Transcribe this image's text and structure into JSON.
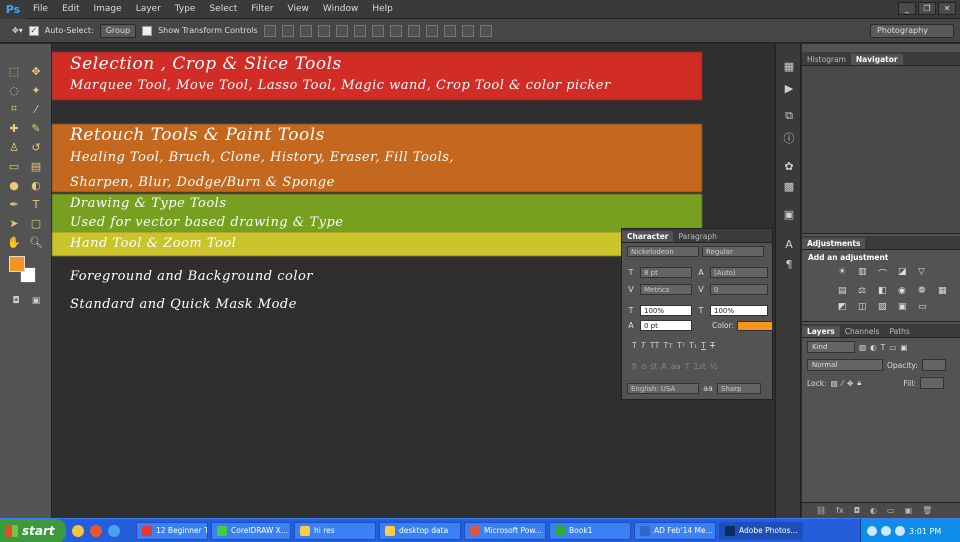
{
  "app": {
    "logo": "Ps"
  },
  "menu": [
    "File",
    "Edit",
    "Image",
    "Layer",
    "Type",
    "Select",
    "Filter",
    "View",
    "Window",
    "Help"
  ],
  "window_controls": [
    "_",
    "❐",
    "✕"
  ],
  "options_bar": {
    "auto_select_label": "Auto-Select:",
    "auto_select_value": "Group",
    "transform_label": "Show Transform Controls",
    "workspace": "Photography"
  },
  "annotations": {
    "selection_title": "Selection , Crop & Slice Tools",
    "selection_desc": "Marquee Tool, Move Tool, Lasso Tool, Magic wand, Crop Tool & color picker",
    "retouch_title": "Retouch Tools & Paint Tools",
    "retouch_desc": "Healing Tool, Bruch, Clone, History, Eraser, Fill Tools,",
    "retouch_desc2": "Sharpen, Blur, Dodge/Burn & Sponge",
    "drawing_title": "Drawing & Type Tools",
    "drawing_desc": "Used for vector based drawing & Type",
    "hand_zoom": "Hand Tool & Zoom Tool",
    "fg_bg": "Foreground and Background color",
    "mask_mode": "Standard and Quick Mask Mode"
  },
  "panels": {
    "histogram_tab": "Histogram",
    "navigator_tab": "Navigator",
    "adjustments_tab": "Adjustments",
    "add_adjustment": "Add an adjustment",
    "layers_tab": "Layers",
    "channels_tab": "Channels",
    "paths_tab": "Paths",
    "kind_label": "Kind",
    "blend_mode": "Normal",
    "opacity_label": "Opacity:",
    "lock_label": "Lock:",
    "fill_label": "Fill:"
  },
  "character": {
    "tab": "Character",
    "tab2": "Paragraph",
    "font": "Nickelodeon",
    "style": "Regular",
    "size": "8 pt",
    "leading": "(Auto)",
    "kerning": "Metrics",
    "tracking": "0",
    "vscale": "100%",
    "hscale": "100%",
    "baseline": "0 pt",
    "color_label": "Color:",
    "language": "English: USA",
    "aa_label": "aa",
    "antialias": "Sharp"
  },
  "taskbar": {
    "start": "start",
    "tasks": [
      "12 Beginner T...",
      "CorelDRAW X...",
      "hi res",
      "desktop data",
      "Microsoft Pow...",
      "Book1",
      "AD Feb'14 Me...",
      "Adobe Photos..."
    ],
    "clock": "3:01 PM"
  },
  "colors": {
    "foreground": "#f7931e",
    "background": "#ffffff",
    "red_band": "#d22c26",
    "orange_band": "#c5681f",
    "green_band": "#77a021",
    "yellow_band": "#cbc32a"
  }
}
